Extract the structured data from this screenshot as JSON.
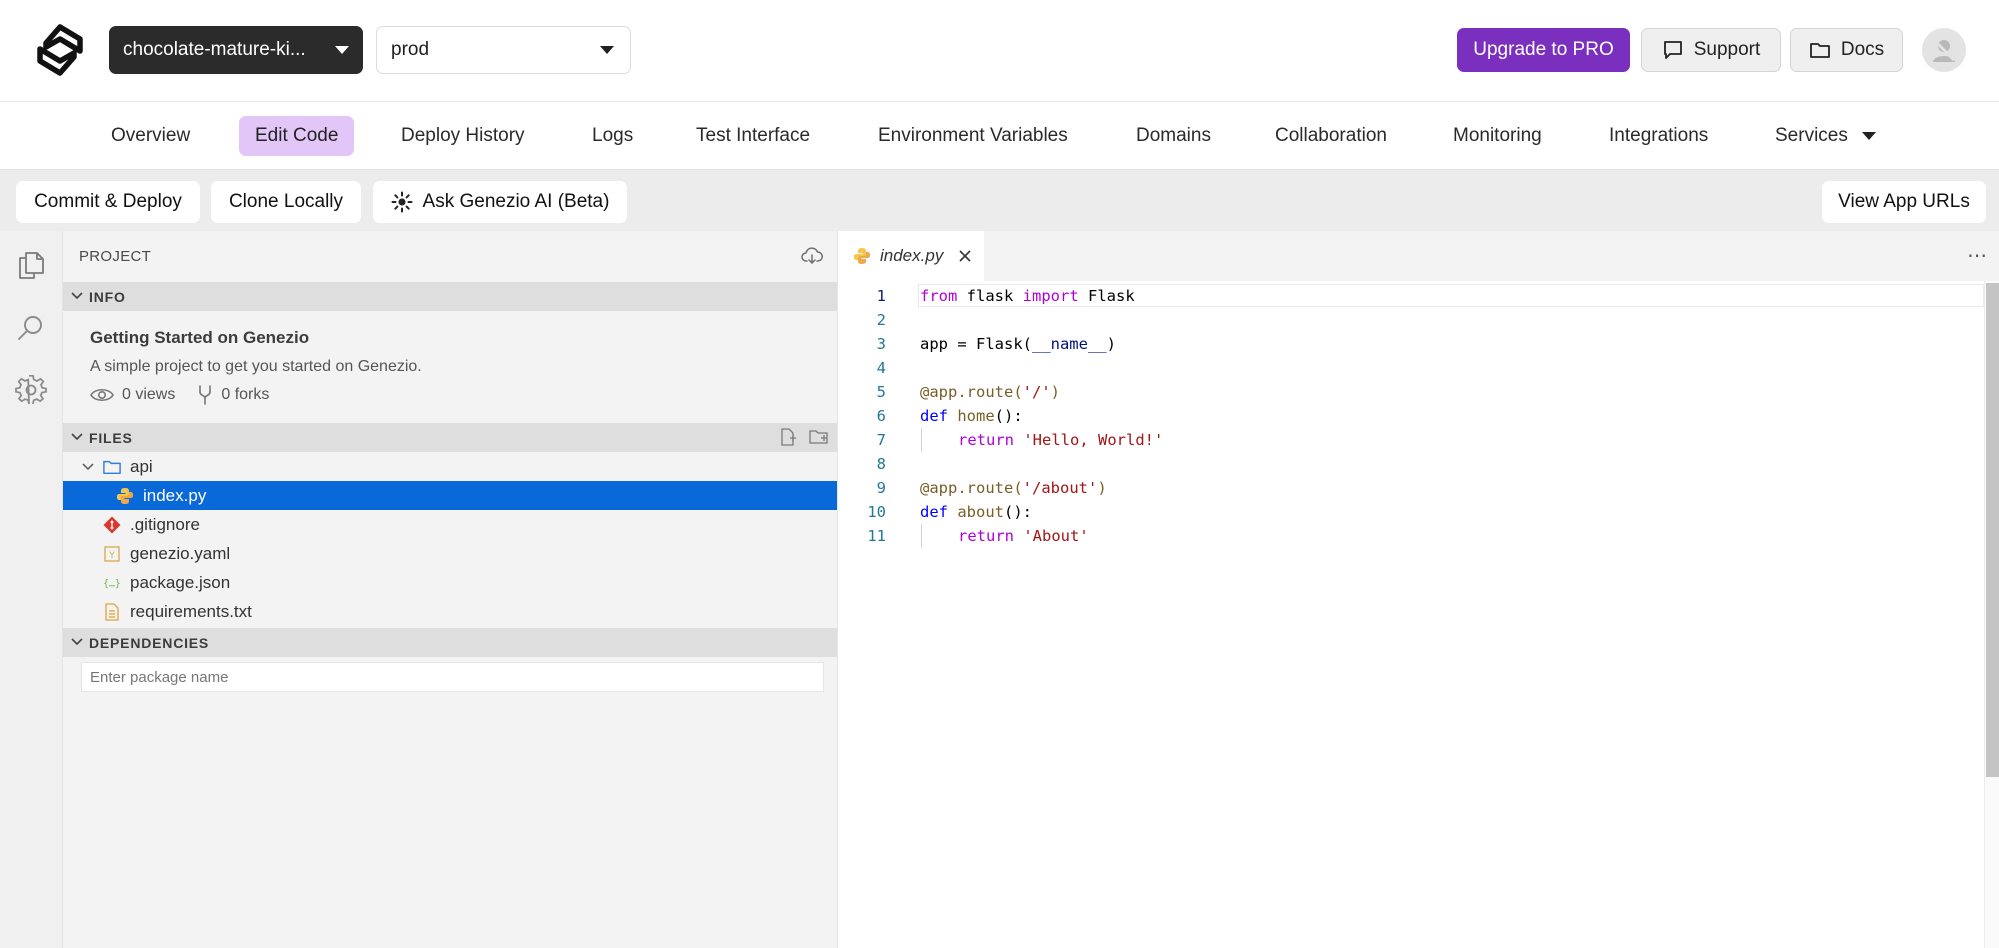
{
  "header": {
    "app_name": "chocolate-mature-ki...",
    "environment": "prod",
    "upgrade_label": "Upgrade to PRO",
    "support_label": "Support",
    "docs_label": "Docs"
  },
  "nav": {
    "tabs": [
      {
        "label": "Overview"
      },
      {
        "label": "Edit Code",
        "active": true
      },
      {
        "label": "Deploy History"
      },
      {
        "label": "Logs"
      },
      {
        "label": "Test Interface"
      },
      {
        "label": "Environment Variables"
      },
      {
        "label": "Domains"
      },
      {
        "label": "Collaboration"
      },
      {
        "label": "Monitoring"
      },
      {
        "label": "Integrations"
      },
      {
        "label": "Services"
      }
    ]
  },
  "actions": {
    "commit_deploy": "Commit & Deploy",
    "clone_locally": "Clone Locally",
    "ask_ai": "Ask Genezio AI (Beta)",
    "view_urls": "View App URLs"
  },
  "sidebar": {
    "title": "PROJECT",
    "info": {
      "header": "INFO",
      "project_title": "Getting Started on Genezio",
      "description": "A simple project to get you started on Genezio.",
      "views": "0 views",
      "forks": "0 forks"
    },
    "files": {
      "header": "FILES",
      "items": [
        {
          "name": "api",
          "type": "folder"
        },
        {
          "name": "index.py",
          "type": "python",
          "selected": true
        },
        {
          "name": ".gitignore",
          "type": "git"
        },
        {
          "name": "genezio.yaml",
          "type": "yaml"
        },
        {
          "name": "package.json",
          "type": "json"
        },
        {
          "name": "requirements.txt",
          "type": "text"
        }
      ]
    },
    "dependencies": {
      "header": "DEPENDENCIES",
      "placeholder": "Enter package name"
    }
  },
  "editor": {
    "tab_label": "index.py",
    "line_numbers": [
      "1",
      "2",
      "3",
      "4",
      "5",
      "6",
      "7",
      "8",
      "9",
      "10",
      "11"
    ],
    "code": {
      "l1_kw_from": "from",
      "l1_mod": " flask ",
      "l1_kw_import": "import",
      "l1_name": " Flask",
      "l3_app": "app = Flask(",
      "l3_dunder": "__name__",
      "l3_close": ")",
      "l5_dec": "@app.route(",
      "l5_str": "'/'",
      "l5_close": ")",
      "l6_def": "def",
      "l6_fn": " home",
      "l6_rest": "():",
      "l7_ret": "return",
      "l7_str": " 'Hello, World!'",
      "l9_dec": "@app.route(",
      "l9_str": "'/about'",
      "l9_close": ")",
      "l10_def": "def",
      "l10_fn": " about",
      "l10_rest": "():",
      "l11_ret": "return",
      "l11_str": " 'About'"
    }
  },
  "colors": {
    "brand_purple": "#7b2fbe",
    "active_tab_bg": "#e1c6f7",
    "selection_blue": "#0a69d9"
  }
}
